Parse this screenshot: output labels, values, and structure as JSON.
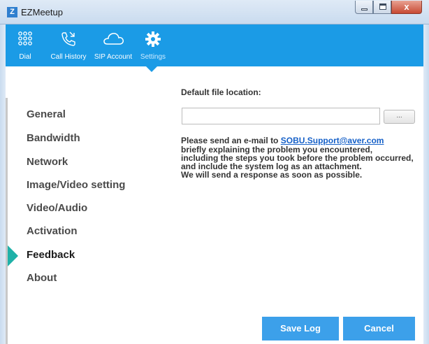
{
  "window": {
    "title": "EZMeetup",
    "app_icon_glyph": "Z",
    "close_glyph": "x"
  },
  "toolbar": {
    "items": [
      {
        "label": "Dial",
        "icon": "dialpad-icon"
      },
      {
        "label": "Call History",
        "icon": "phone-history-icon"
      },
      {
        "label": "SIP Account",
        "icon": "cloud-icon"
      },
      {
        "label": "Settings",
        "icon": "gear-icon",
        "active": true
      }
    ]
  },
  "nav": {
    "items": [
      {
        "label": "General"
      },
      {
        "label": "Bandwidth"
      },
      {
        "label": "Network"
      },
      {
        "label": "Image/Video setting"
      },
      {
        "label": "Video/Audio"
      },
      {
        "label": "Activation"
      },
      {
        "label": "Feedback",
        "active": true
      },
      {
        "label": "About"
      }
    ]
  },
  "feedback": {
    "default_location_label": "Default file location:",
    "file_location_value": "",
    "browse_label": "...",
    "message_prefix": "Please send an e-mail to ",
    "email": "SOBU.Support@aver.com",
    "lines": [
      "briefly explaining the problem you encountered,",
      "including the steps you took before the problem occurred,",
      "and include the system log as an attachment.",
      "We will send a response as soon as possible."
    ],
    "save_log_label": "Save Log",
    "cancel_label": "Cancel"
  },
  "colors": {
    "toolbar": "#1b9be6",
    "button": "#3ca0ea",
    "indicator": "#1fb1a8",
    "link": "#1560c8"
  }
}
